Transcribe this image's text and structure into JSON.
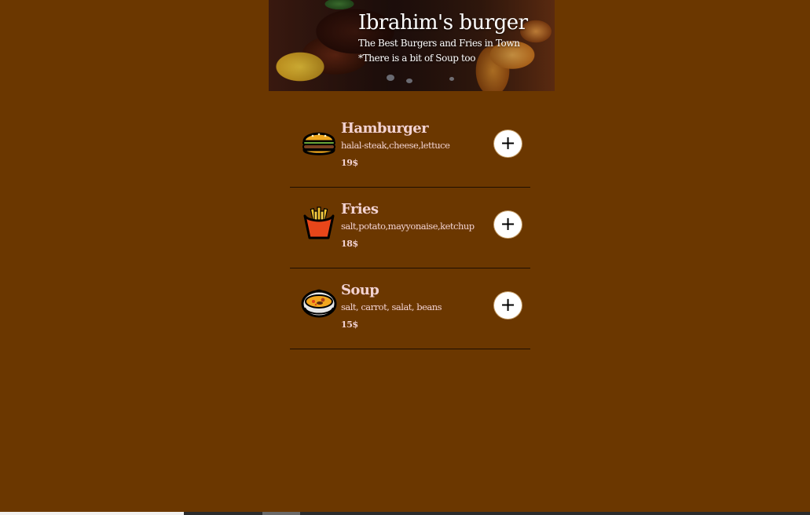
{
  "header": {
    "title": "Ibrahim's burger",
    "subtitle": "The Best Burgers and Fries in Town",
    "note": "*There is a bit of Soup too"
  },
  "menu": {
    "add_label": "+",
    "items": [
      {
        "name": "Hamburger",
        "ingredients": "halal-steak,cheese,lettuce",
        "price": "19$",
        "icon": "hamburger-icon"
      },
      {
        "name": "Fries",
        "ingredients": "salt,potato,mayyonaise,ketchup",
        "price": "18$",
        "icon": "fries-icon"
      },
      {
        "name": "Soup",
        "ingredients": "salt, carrot, salat, beans",
        "price": "15$",
        "icon": "soup-icon"
      }
    ]
  },
  "colors": {
    "background": "#6b3700",
    "text": "#f2d2d2",
    "divider": "#1e0e02"
  }
}
